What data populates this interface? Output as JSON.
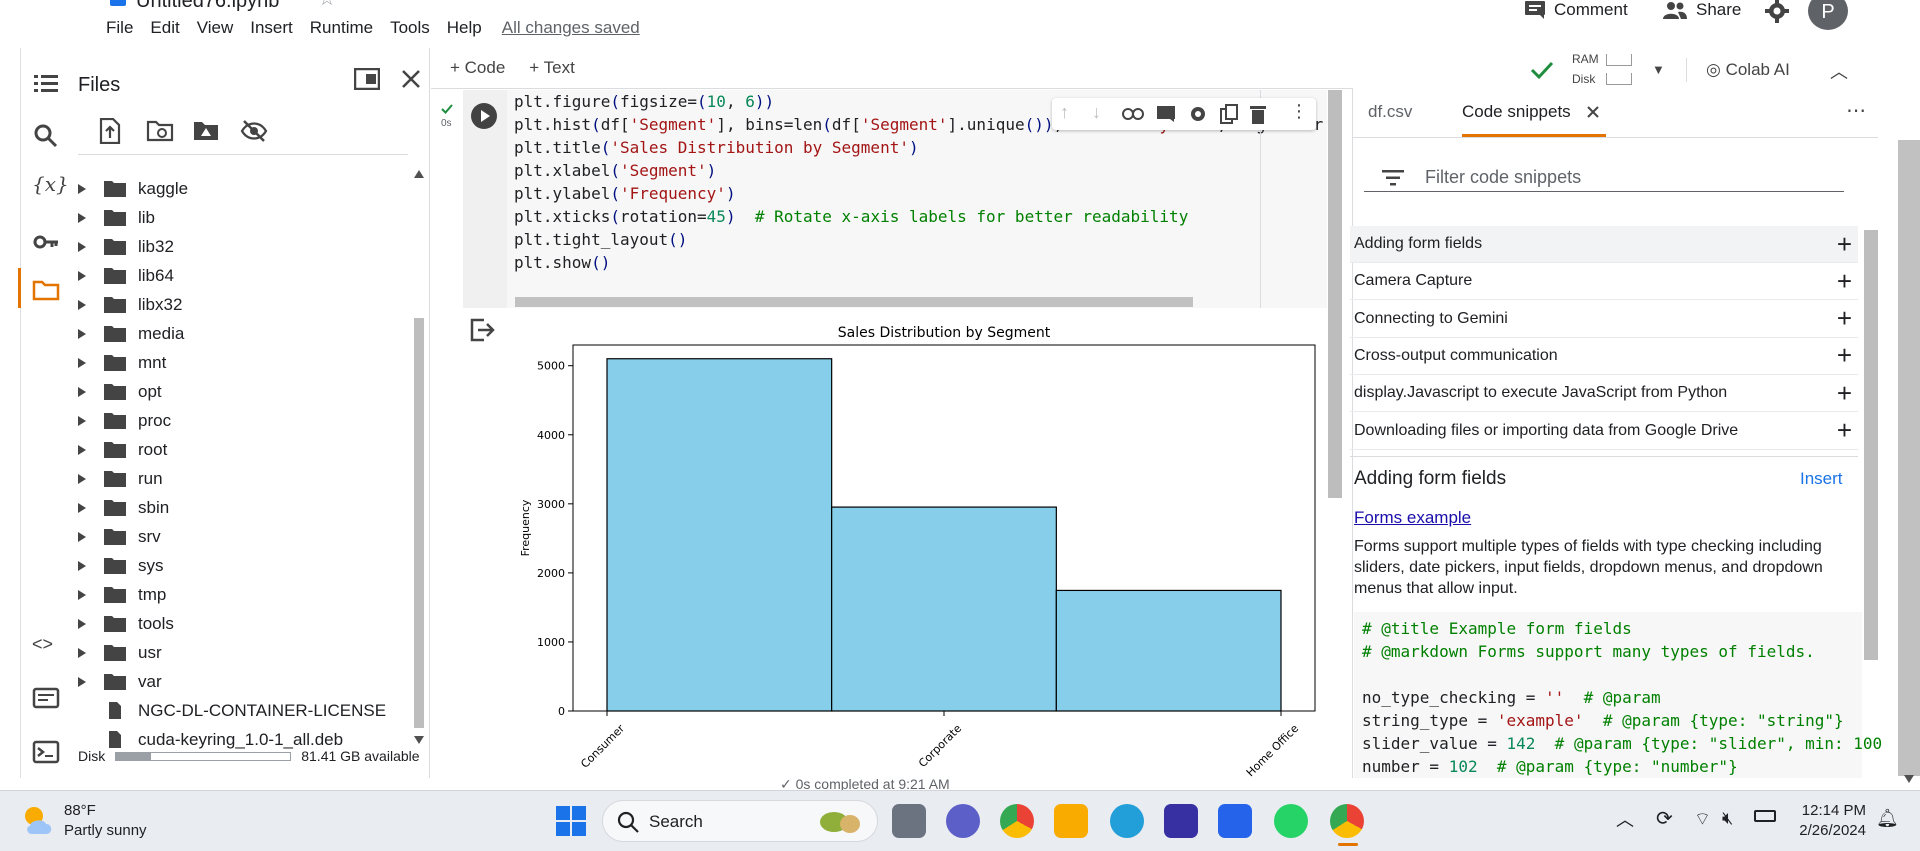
{
  "header": {
    "doc_title": "Untitled76.ipynb",
    "menu": [
      "File",
      "Edit",
      "View",
      "Insert",
      "Runtime",
      "Tools",
      "Help"
    ],
    "saved_status": "All changes saved",
    "comment_label": "Comment",
    "share_label": "Share",
    "avatar_letter": "P",
    "ram_label": "RAM",
    "disk_label": "Disk",
    "colab_ai_label": "Colab AI"
  },
  "notebook_toolbar": {
    "code_label": "+ Code",
    "text_label": "+ Text"
  },
  "files": {
    "title": "Files",
    "items": [
      {
        "name": "kaggle",
        "type": "folder"
      },
      {
        "name": "lib",
        "type": "folder"
      },
      {
        "name": "lib32",
        "type": "folder"
      },
      {
        "name": "lib64",
        "type": "folder"
      },
      {
        "name": "libx32",
        "type": "folder"
      },
      {
        "name": "media",
        "type": "folder"
      },
      {
        "name": "mnt",
        "type": "folder"
      },
      {
        "name": "opt",
        "type": "folder"
      },
      {
        "name": "proc",
        "type": "folder"
      },
      {
        "name": "root",
        "type": "folder"
      },
      {
        "name": "run",
        "type": "folder"
      },
      {
        "name": "sbin",
        "type": "folder"
      },
      {
        "name": "srv",
        "type": "folder"
      },
      {
        "name": "sys",
        "type": "folder"
      },
      {
        "name": "tmp",
        "type": "folder"
      },
      {
        "name": "tools",
        "type": "folder"
      },
      {
        "name": "usr",
        "type": "folder"
      },
      {
        "name": "var",
        "type": "folder"
      },
      {
        "name": "NGC-DL-CONTAINER-LICENSE",
        "type": "file"
      },
      {
        "name": "cuda-keyring_1.0-1_all.deb",
        "type": "file"
      }
    ],
    "disk_label": "Disk",
    "disk_available": "81.41 GB available",
    "disk_used_fraction": 0.2
  },
  "cell": {
    "exec_time": "0s",
    "code_lines": [
      "plt.figure(figsize=(10, 6))",
      "plt.hist(df['Segment'], bins=len(df['Segment'].unique()), color='skyblue', edgecolor",
      "plt.title('Sales Distribution by Segment')",
      "plt.xlabel('Segment')",
      "plt.ylabel('Frequency')",
      "plt.xticks(rotation=45)  # Rotate x-axis labels for better readability",
      "plt.tight_layout()",
      "plt.show()"
    ]
  },
  "chart_data": {
    "type": "bar",
    "title": "Sales Distribution by Segment",
    "xlabel": "",
    "ylabel": "Frequency",
    "categories": [
      "Consumer",
      "Corporate",
      "Home Office"
    ],
    "values": [
      5101,
      2953,
      1746
    ],
    "ylim": [
      0,
      5300
    ],
    "yticks": [
      0,
      1000,
      2000,
      3000,
      4000,
      5000
    ],
    "bar_color": "#87ceeb",
    "edge_color": "#000000",
    "grid": false
  },
  "status_line": "✓  0s    completed at 9:21 AM",
  "snippets": {
    "tab_df": "df.csv",
    "tab_snippets": "Code snippets",
    "filter_placeholder": "Filter code snippets",
    "items": [
      "Adding form fields",
      "Camera Capture",
      "Connecting to Gemini",
      "Cross-output communication",
      "display.Javascript to execute JavaScript from Python",
      "Downloading files or importing data from Google Drive"
    ],
    "detail_title": "Adding form fields",
    "insert_label": "Insert",
    "link_label": "Forms example",
    "description": "Forms support multiple types of fields with type checking including sliders, date pickers, input fields, dropdown menus, and dropdown menus that allow input.",
    "code_lines": [
      "# @title Example form fields",
      "# @markdown Forms support many types of fields.",
      "",
      "no_type_checking = ''  # @param",
      "string_type = 'example'  # @param {type: \"string\"}",
      "slider_value = 142  # @param {type: \"slider\", min: 100",
      "number = 102  # @param {type: \"number\"}"
    ]
  },
  "taskbar": {
    "weather_temp": "88°F",
    "weather_desc": "Partly sunny",
    "search_label": "Search",
    "time": "12:14 PM",
    "date": "2/26/2024"
  },
  "colors": {
    "accent": "#e37400",
    "link": "#1a73e8",
    "check": "#1e8e3e"
  }
}
